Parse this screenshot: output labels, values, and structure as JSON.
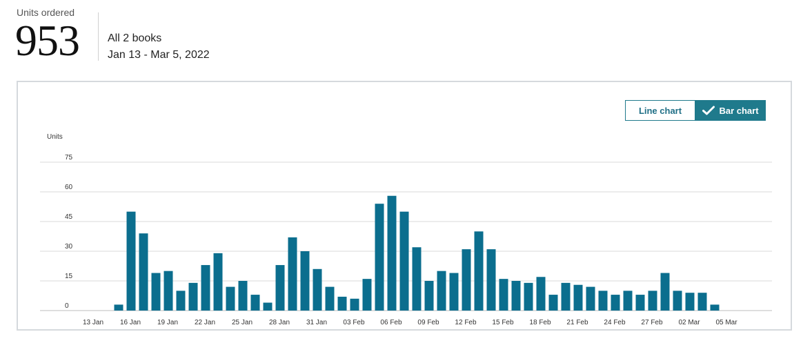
{
  "summary": {
    "label": "Units ordered",
    "value": "953",
    "scope": "All 2 books",
    "range": "Jan 13 - Mar 5, 2022"
  },
  "toggle": {
    "line_label": "Line chart",
    "bar_label": "Bar chart",
    "selected": "bar"
  },
  "colors": {
    "bar": "#0b6e8e",
    "accent": "#1f7a8c",
    "grid": "#d9d9d9"
  },
  "chart_data": {
    "type": "bar",
    "ylabel": "Units",
    "ylim": [
      0,
      75
    ],
    "yticks": [
      0,
      15,
      30,
      45,
      60,
      75
    ],
    "grid": true,
    "x_tick_labels": [
      "13 Jan",
      "16 Jan",
      "19 Jan",
      "22 Jan",
      "25 Jan",
      "28 Jan",
      "31 Jan",
      "03 Feb",
      "06 Feb",
      "09 Feb",
      "12 Feb",
      "15 Feb",
      "18 Feb",
      "21 Feb",
      "24 Feb",
      "27 Feb",
      "02 Mar",
      "05 Mar"
    ],
    "categories": [
      "13 Jan",
      "14 Jan",
      "15 Jan",
      "16 Jan",
      "17 Jan",
      "18 Jan",
      "19 Jan",
      "20 Jan",
      "21 Jan",
      "22 Jan",
      "23 Jan",
      "24 Jan",
      "25 Jan",
      "26 Jan",
      "27 Jan",
      "28 Jan",
      "29 Jan",
      "30 Jan",
      "31 Jan",
      "01 Feb",
      "02 Feb",
      "03 Feb",
      "04 Feb",
      "05 Feb",
      "06 Feb",
      "07 Feb",
      "08 Feb",
      "09 Feb",
      "10 Feb",
      "11 Feb",
      "12 Feb",
      "13 Feb",
      "14 Feb",
      "15 Feb",
      "16 Feb",
      "17 Feb",
      "18 Feb",
      "19 Feb",
      "20 Feb",
      "21 Feb",
      "22 Feb",
      "23 Feb",
      "24 Feb",
      "25 Feb",
      "26 Feb",
      "27 Feb",
      "28 Feb",
      "01 Mar",
      "02 Mar",
      "03 Mar",
      "04 Mar",
      "05 Mar"
    ],
    "values": [
      0,
      0,
      0,
      3,
      50,
      39,
      19,
      20,
      10,
      14,
      23,
      29,
      12,
      15,
      8,
      4,
      23,
      37,
      30,
      21,
      12,
      7,
      6,
      16,
      54,
      58,
      50,
      32,
      15,
      20,
      19,
      31,
      40,
      31,
      16,
      15,
      14,
      17,
      8,
      14,
      13,
      12,
      10,
      8,
      10,
      8,
      10,
      19,
      10,
      9,
      9,
      3
    ]
  }
}
